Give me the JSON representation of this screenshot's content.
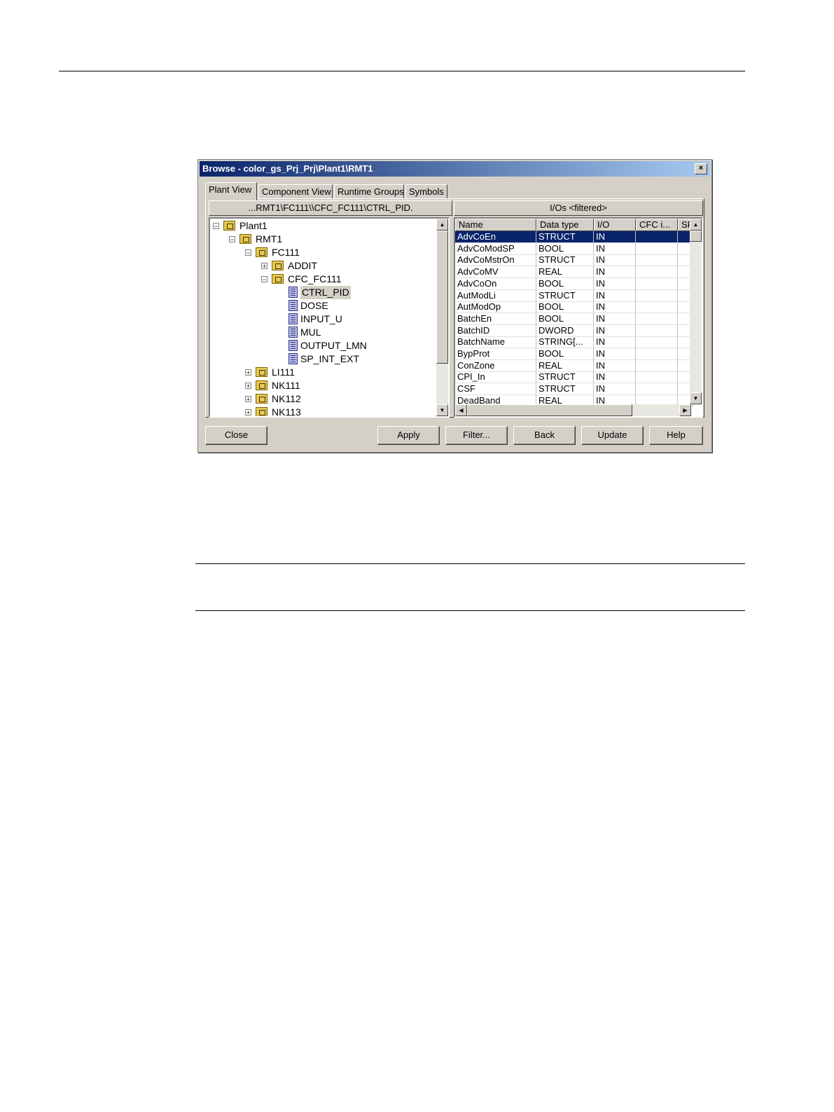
{
  "window": {
    "title": "Browse - color_gs_Prj_Prj\\Plant1\\RMT1",
    "close_glyph": "×"
  },
  "tabs": [
    {
      "label": "Plant View",
      "active": true
    },
    {
      "label": "Component View",
      "active": false
    },
    {
      "label": "Runtime Groups",
      "active": false
    },
    {
      "label": "Symbols",
      "active": false
    }
  ],
  "left_pane": {
    "header": "...RMT1\\FC111\\\\CFC_FC111\\CTRL_PID.",
    "tree": [
      {
        "label": "Plant1",
        "level": 0,
        "expander": "−",
        "icon": "folder-icon"
      },
      {
        "label": "RMT1",
        "level": 1,
        "expander": "−",
        "icon": "folder-icon"
      },
      {
        "label": "FC111",
        "level": 2,
        "expander": "−",
        "icon": "folder-icon"
      },
      {
        "label": "ADDIT",
        "level": 3,
        "expander": "+",
        "icon": "folder-icon"
      },
      {
        "label": "CFC_FC111",
        "level": 3,
        "expander": "−",
        "icon": "chart-icon"
      },
      {
        "label": "CTRL_PID",
        "level": 4,
        "expander": "",
        "icon": "block-icon",
        "selected": true
      },
      {
        "label": "DOSE",
        "level": 4,
        "expander": "",
        "icon": "block-icon"
      },
      {
        "label": "INPUT_U",
        "level": 4,
        "expander": "",
        "icon": "block-icon"
      },
      {
        "label": "MUL",
        "level": 4,
        "expander": "",
        "icon": "block-icon"
      },
      {
        "label": "OUTPUT_LMN",
        "level": 4,
        "expander": "",
        "icon": "block-icon"
      },
      {
        "label": "SP_INT_EXT",
        "level": 4,
        "expander": "",
        "icon": "block-icon"
      },
      {
        "label": "LI111",
        "level": 2,
        "expander": "+",
        "icon": "folder-icon"
      },
      {
        "label": "NK111",
        "level": 2,
        "expander": "+",
        "icon": "folder-icon"
      },
      {
        "label": "NK112",
        "level": 2,
        "expander": "+",
        "icon": "folder-icon"
      },
      {
        "label": "NK113",
        "level": 2,
        "expander": "+",
        "icon": "folder-icon"
      }
    ]
  },
  "right_pane": {
    "header": "I/Os <filtered>",
    "columns": [
      "Name",
      "Data type",
      "I/O",
      "CFC i...",
      "SF"
    ],
    "rows": [
      {
        "name": "AdvCoEn",
        "type": "STRUCT",
        "io": "IN",
        "selected": true
      },
      {
        "name": "AdvCoModSP",
        "type": "BOOL",
        "io": "IN"
      },
      {
        "name": "AdvCoMstrOn",
        "type": "STRUCT",
        "io": "IN"
      },
      {
        "name": "AdvCoMV",
        "type": "REAL",
        "io": "IN"
      },
      {
        "name": "AdvCoOn",
        "type": "BOOL",
        "io": "IN"
      },
      {
        "name": "AutModLi",
        "type": "STRUCT",
        "io": "IN"
      },
      {
        "name": "AutModOp",
        "type": "BOOL",
        "io": "IN"
      },
      {
        "name": "BatchEn",
        "type": "BOOL",
        "io": "IN"
      },
      {
        "name": "BatchID",
        "type": "DWORD",
        "io": "IN"
      },
      {
        "name": "BatchName",
        "type": "STRING[...",
        "io": "IN"
      },
      {
        "name": "BypProt",
        "type": "BOOL",
        "io": "IN"
      },
      {
        "name": "ConZone",
        "type": "REAL",
        "io": "IN"
      },
      {
        "name": "CPI_In",
        "type": "STRUCT",
        "io": "IN"
      },
      {
        "name": "CSF",
        "type": "STRUCT",
        "io": "IN"
      },
      {
        "name": "DeadBand",
        "type": "REAL",
        "io": "IN"
      }
    ]
  },
  "buttons": {
    "close": "Close",
    "apply": "Apply",
    "filter": "Filter...",
    "back": "Back",
    "update": "Update",
    "help": "Help"
  },
  "scroll_glyphs": {
    "up": "▲",
    "down": "▼",
    "left": "◀",
    "right": "▶"
  }
}
